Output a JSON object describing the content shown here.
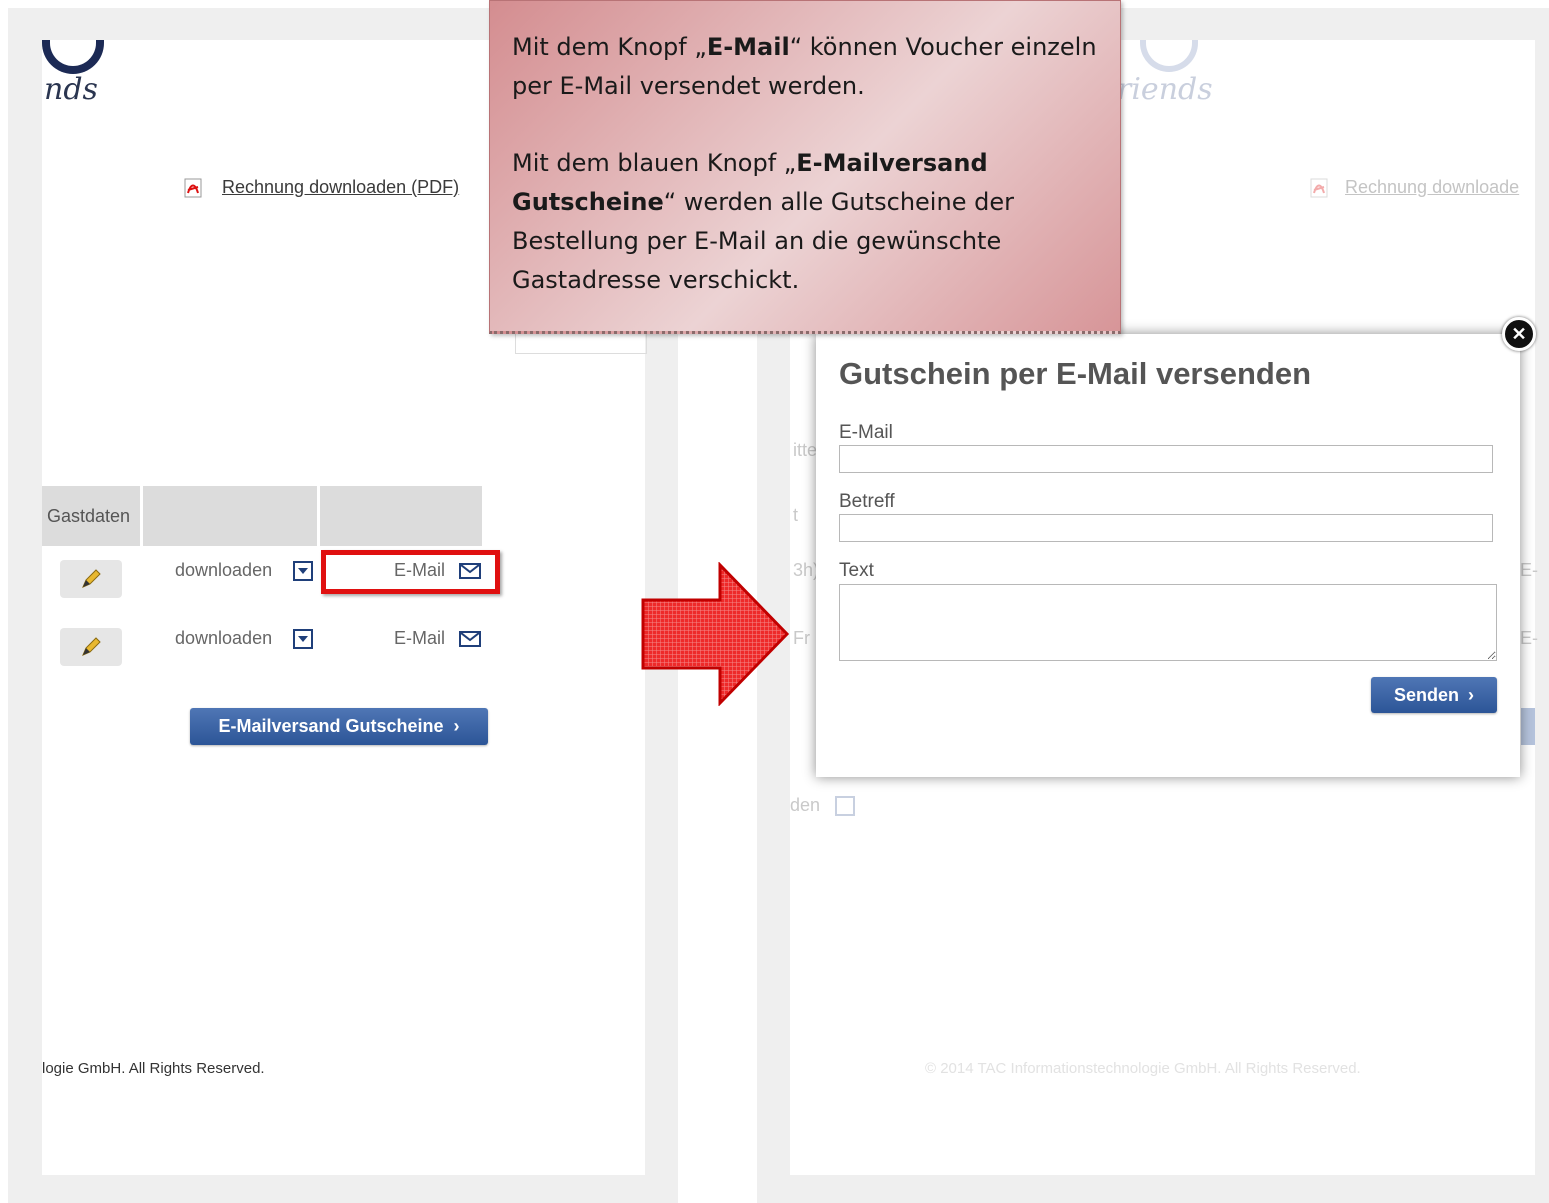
{
  "callout": {
    "p1_pre": "Mit dem Knopf „",
    "p1_bold": "E-Mail",
    "p1_post": "“ können Voucher einzeln per E-Mail versendet werden.",
    "p2_pre": "Mit dem blauen Knopf  „",
    "p2_bold": "E-Mailversand Gutscheine",
    "p2_post": "“ werden alle Gutscheine der Bestellung per E-Mail an die gewünschte Gastadresse verschickt."
  },
  "left": {
    "logo_text": "nds",
    "invoice_link": "Rechnung downloaden (PDF)",
    "table": {
      "headers": [
        "Gastdaten",
        "",
        ""
      ],
      "rows": [
        {
          "download": "downloaden",
          "email": "E-Mail"
        },
        {
          "download": "downloaden",
          "email": "E-Mail"
        }
      ]
    },
    "bulk_button": "E-Mailversand Gutscheine",
    "footer": "logie GmbH. All Rights Reserved."
  },
  "right": {
    "logo_text": "riends",
    "invoice_link": "Rechnung downloade",
    "bg_footer": "© 2014 TAC Informationstechnologie GmbH. All Rights Reserved.",
    "bg_download": "den",
    "bg_frag": [
      "itte",
      "t",
      "3h)",
      "Fr",
      "E-",
      "E-"
    ]
  },
  "modal": {
    "title": "Gutschein per E-Mail versenden",
    "email_label": "E-Mail",
    "subject_label": "Betreff",
    "text_label": "Text",
    "email_value": "",
    "subject_value": "",
    "text_value": "",
    "send_button": "Senden"
  },
  "colors": {
    "highlight": "#e01010",
    "button_blue": "#2c5597",
    "callout": "#e8c4c5"
  },
  "icons": [
    "pdf-icon",
    "pencil-icon",
    "dropdown-arrow-icon",
    "envelope-icon",
    "chevron-right-icon",
    "close-icon",
    "arrow-right-icon"
  ]
}
